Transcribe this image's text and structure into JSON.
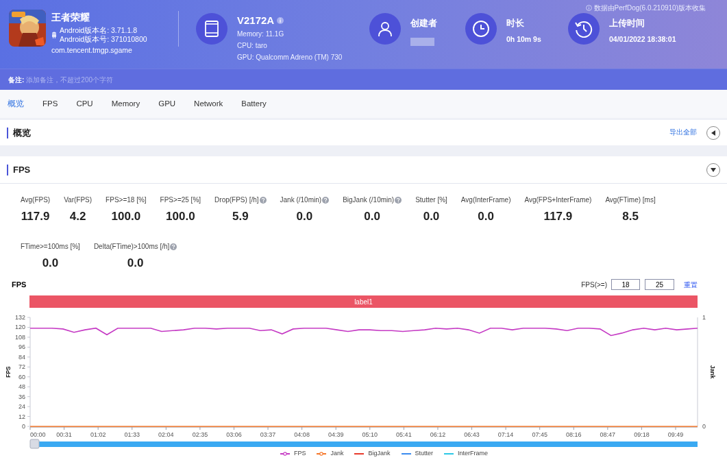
{
  "header": {
    "app": {
      "name": "王者荣耀",
      "version_name": "Android版本名: 3.71.1.8",
      "version_code": "Android版本号: 371010800",
      "package": "com.tencent.tmgp.sgame"
    },
    "device": {
      "model": "V2172A",
      "memory": "Memory: 11.1G",
      "cpu": "CPU: taro",
      "gpu": "GPU: Qualcomm Adreno (TM) 730"
    },
    "creator": {
      "label": "创建者"
    },
    "duration": {
      "label": "时长",
      "value": "0h 10m 9s"
    },
    "upload": {
      "label": "上传时间",
      "value": "04/01/2022 18:38:01"
    },
    "source_note": "数据由PerfDog(6.0.210910)版本收集"
  },
  "note": {
    "label": "备注:",
    "placeholder": "添加备注，不超过200个字符"
  },
  "tabs": [
    {
      "label": "概览",
      "selected": true
    },
    {
      "label": "FPS",
      "selected": false
    },
    {
      "label": "CPU",
      "selected": false
    },
    {
      "label": "Memory",
      "selected": false
    },
    {
      "label": "GPU",
      "selected": false
    },
    {
      "label": "Network",
      "selected": false
    },
    {
      "label": "Battery",
      "selected": false
    }
  ],
  "overview": {
    "title": "概览",
    "export_link": "导出全部"
  },
  "fps_section": {
    "title": "FPS",
    "metrics": [
      {
        "label": "Avg(FPS)",
        "value": "117.9",
        "help": false
      },
      {
        "label": "Var(FPS)",
        "value": "4.2",
        "help": false
      },
      {
        "label": "FPS>=18 [%]",
        "value": "100.0",
        "help": false
      },
      {
        "label": "FPS>=25 [%]",
        "value": "100.0",
        "help": false
      },
      {
        "label": "Drop(FPS) [/h]",
        "value": "5.9",
        "help": true
      },
      {
        "label": "Jank (/10min)",
        "value": "0.0",
        "help": true
      },
      {
        "label": "BigJank (/10min)",
        "value": "0.0",
        "help": true
      },
      {
        "label": "Stutter [%]",
        "value": "0.0",
        "help": false
      },
      {
        "label": "Avg(InterFrame)",
        "value": "0.0",
        "help": false
      },
      {
        "label": "Avg(FPS+InterFrame)",
        "value": "117.9",
        "help": false
      },
      {
        "label": "Avg(FTime) [ms]",
        "value": "8.5",
        "help": false
      },
      {
        "label": "FTime>=100ms [%]",
        "value": "0.0",
        "help": false
      },
      {
        "label": "Delta(FTime)>100ms [/h]",
        "value": "0.0",
        "help": true
      }
    ]
  },
  "chart": {
    "title": "FPS",
    "threshold_label": "FPS(>=)",
    "thresholds": [
      "18",
      "25"
    ],
    "reset_link": "重置",
    "band_label": "label1",
    "y2_label": "Jank",
    "y2_ticks": [
      "1",
      "0"
    ],
    "chart_data": {
      "type": "line",
      "ylabel": "FPS",
      "legend": "bottom",
      "x": [
        0,
        10,
        20,
        30,
        40,
        50,
        60,
        70,
        80,
        90,
        100,
        110,
        120,
        130,
        140,
        150,
        160,
        170,
        180,
        190,
        200,
        210,
        220,
        230,
        240,
        250,
        260,
        270,
        280,
        290,
        300,
        310,
        320,
        330,
        340,
        350,
        360,
        370,
        380,
        390,
        400,
        410,
        420,
        430,
        440,
        450,
        460,
        470,
        480,
        490,
        500,
        510,
        520,
        530,
        540,
        550,
        560,
        570,
        580,
        590,
        600,
        609
      ],
      "xlim": [
        0,
        609
      ],
      "ylim": [
        0,
        132
      ],
      "xticks": [
        {
          "value": 0,
          "label": "00:00"
        },
        {
          "value": 31,
          "label": "00:31"
        },
        {
          "value": 62,
          "label": "01:02"
        },
        {
          "value": 93,
          "label": "01:33"
        },
        {
          "value": 124,
          "label": "02:04"
        },
        {
          "value": 155,
          "label": "02:35"
        },
        {
          "value": 186,
          "label": "03:06"
        },
        {
          "value": 217,
          "label": "03:37"
        },
        {
          "value": 248,
          "label": "04:08"
        },
        {
          "value": 279,
          "label": "04:39"
        },
        {
          "value": 310,
          "label": "05:10"
        },
        {
          "value": 341,
          "label": "05:41"
        },
        {
          "value": 372,
          "label": "06:12"
        },
        {
          "value": 403,
          "label": "06:43"
        },
        {
          "value": 434,
          "label": "07:14"
        },
        {
          "value": 465,
          "label": "07:45"
        },
        {
          "value": 496,
          "label": "08:16"
        },
        {
          "value": 527,
          "label": "08:47"
        },
        {
          "value": 558,
          "label": "09:18"
        },
        {
          "value": 589,
          "label": "09:49"
        }
      ],
      "yticks": [
        0,
        12,
        24,
        36,
        48,
        60,
        72,
        84,
        96,
        108,
        120,
        132
      ],
      "series": [
        {
          "name": "FPS",
          "color": "#c53ac4",
          "values": [
            119,
            119,
            119,
            118,
            114,
            117,
            119,
            111,
            119,
            119,
            119,
            119,
            115,
            116,
            117,
            119,
            119,
            118,
            119,
            119,
            119,
            116,
            117,
            112,
            118,
            119,
            119,
            119,
            117,
            115,
            117,
            117,
            116,
            116,
            115,
            116,
            117,
            119,
            118,
            119,
            117,
            113,
            119,
            119,
            117,
            119,
            119,
            119,
            118,
            116,
            119,
            119,
            118,
            110,
            113,
            117,
            119,
            117,
            119,
            117,
            118,
            119
          ]
        },
        {
          "name": "Jank",
          "color": "#f5772a",
          "values": [
            0,
            0,
            0,
            0,
            0,
            0,
            0,
            0,
            0,
            0,
            0,
            0,
            0,
            0,
            0,
            0,
            0,
            0,
            0,
            0,
            0,
            0,
            0,
            0,
            0,
            0,
            0,
            0,
            0,
            0,
            0,
            0,
            0,
            0,
            0,
            0,
            0,
            0,
            0,
            0,
            0,
            0,
            0,
            0,
            0,
            0,
            0,
            0,
            0,
            0,
            0,
            0,
            0,
            0,
            0,
            0,
            0,
            0,
            0,
            0,
            0,
            0
          ]
        }
      ]
    },
    "extra_legend": [
      {
        "label": "BigJank",
        "color": "#e8392b"
      },
      {
        "label": "Stutter",
        "color": "#3a8bef"
      },
      {
        "label": "InterFrame",
        "color": "#2bc7e6"
      }
    ]
  }
}
